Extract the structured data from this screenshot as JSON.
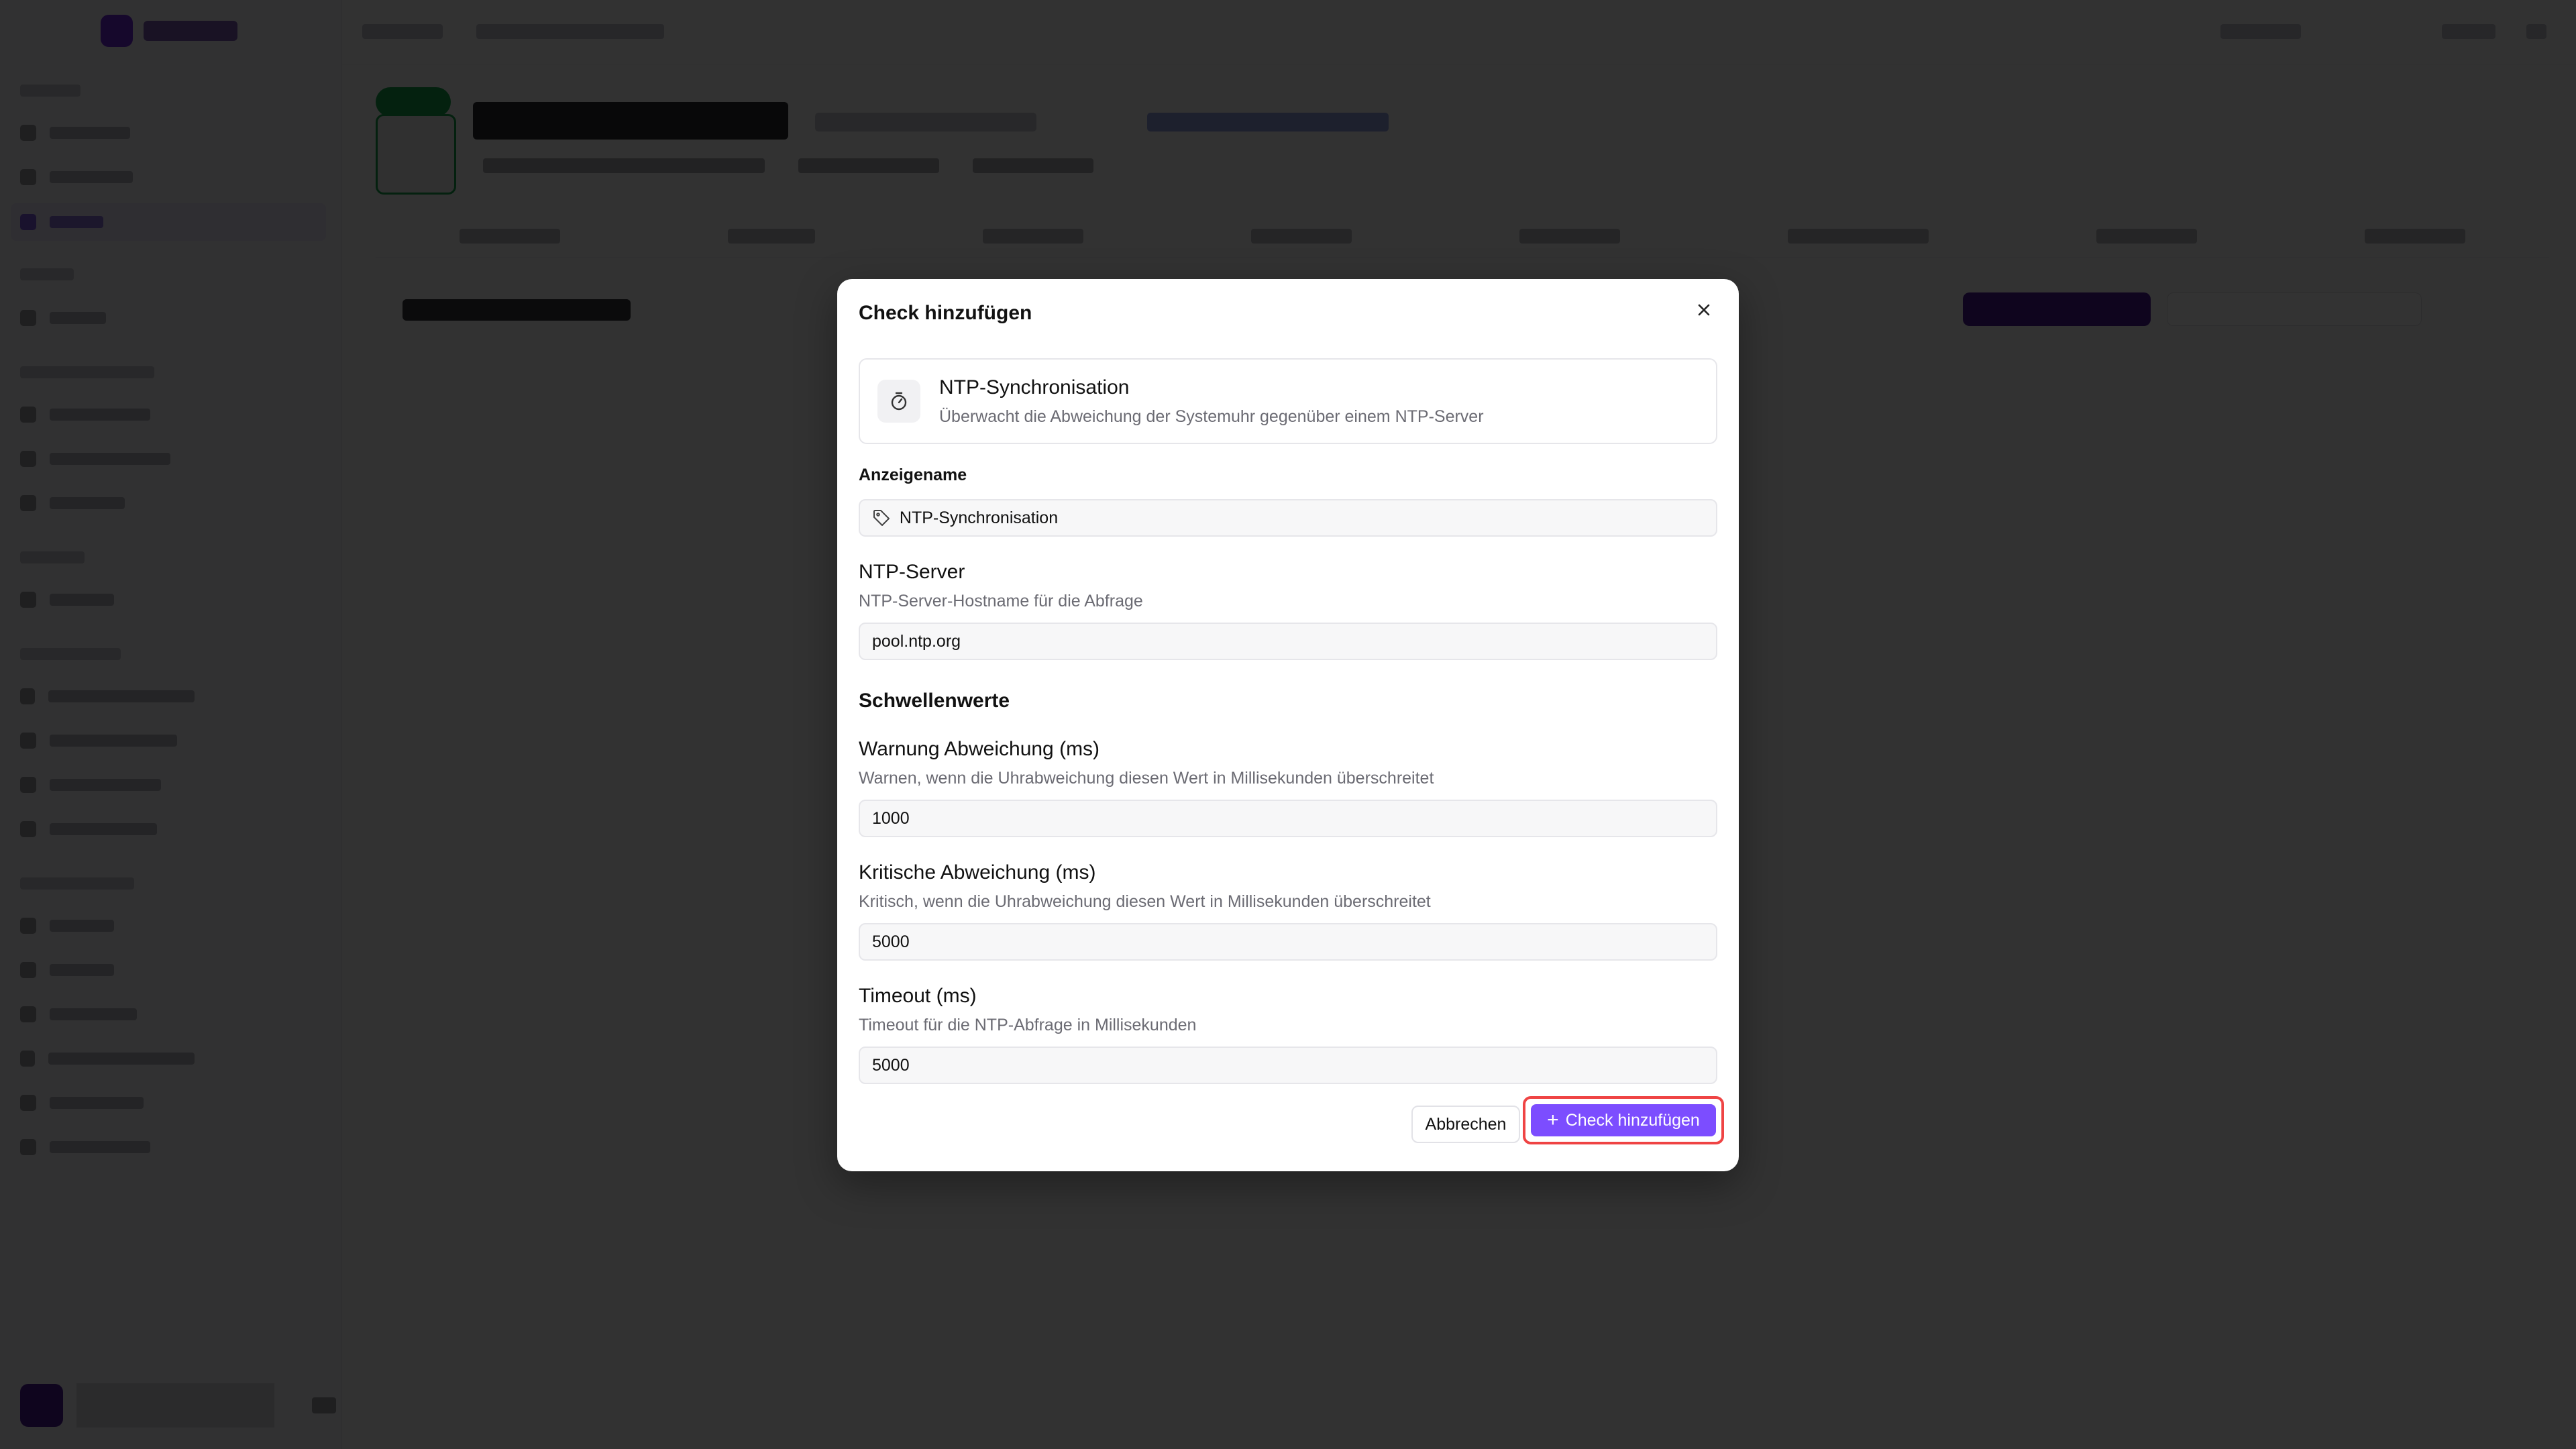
{
  "background": {
    "app_name": "",
    "breadcrumb": [],
    "status_badge": "",
    "device_title": "",
    "section_title": "",
    "add_button_label": "",
    "search_placeholder": ""
  },
  "dialog": {
    "title": "Check hinzufügen",
    "close_icon": "close-icon",
    "check_type": {
      "icon": "timer-icon",
      "name": "NTP-Synchronisation",
      "description": "Überwacht die Abweichung der Systemuhr gegenüber einem NTP-Server"
    },
    "display_name": {
      "label": "Anzeigename",
      "icon": "tag-icon",
      "value": "NTP-Synchronisation"
    },
    "ntp_server": {
      "label": "NTP-Server",
      "help": "NTP-Server-Hostname für die Abfrage",
      "value": "pool.ntp.org"
    },
    "thresholds": {
      "title": "Schwellenwerte",
      "warning": {
        "label": "Warnung Abweichung (ms)",
        "help": "Warnen, wenn die Uhrabweichung diesen Wert in Millisekunden überschreitet",
        "value": "1000"
      },
      "critical": {
        "label": "Kritische Abweichung (ms)",
        "help": "Kritisch, wenn die Uhrabweichung diesen Wert in Millisekunden überschreitet",
        "value": "5000"
      }
    },
    "timeout": {
      "label": "Timeout (ms)",
      "help": "Timeout für die NTP-Abfrage in Millisekunden",
      "value": "5000"
    },
    "buttons": {
      "cancel": "Abbrechen",
      "submit_icon": "plus-icon",
      "submit": "Check hinzufügen"
    }
  },
  "colors": {
    "accent": "#7c4dff",
    "highlight": "#ef4444",
    "overlay": "rgba(0,0,0,0.80)"
  }
}
